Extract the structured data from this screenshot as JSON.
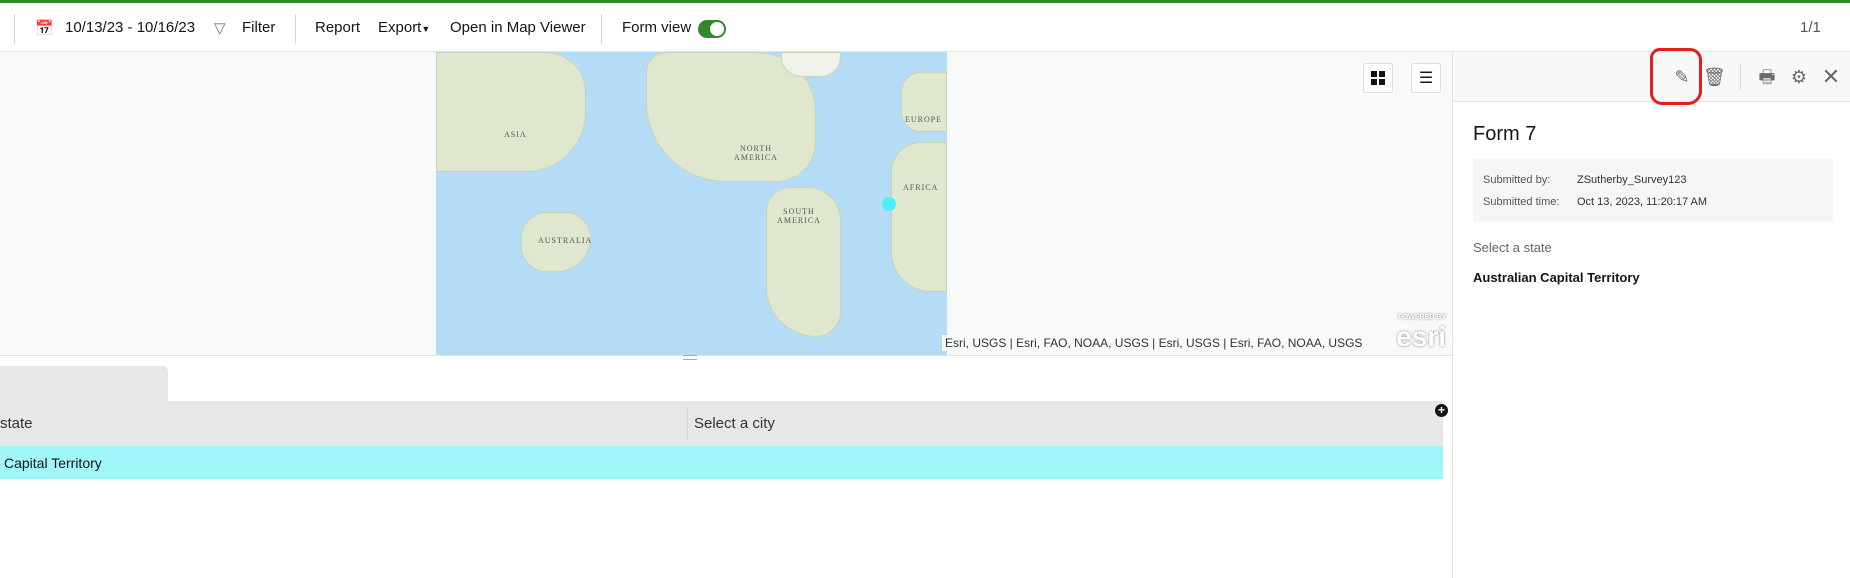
{
  "toolbar": {
    "date_range": "10/13/23 - 10/16/23",
    "filter_label": "Filter",
    "report_label": "Report",
    "export_label": "Export",
    "open_map_viewer_label": "Open in Map Viewer",
    "form_view_label": "Form view",
    "form_view_on": true,
    "record_count": "1/1"
  },
  "map": {
    "labels": [
      "ASIA",
      "NORTH AMERICA",
      "EUROPE",
      "AFRICA",
      "SOUTH AMERICA",
      "AUSTRALIA"
    ],
    "attribution": "Esri, USGS | Esri, FAO, NOAA, USGS | Esri, USGS | Esri, FAO, NOAA, USGS",
    "logo_text": "POWERED BY esri",
    "point_color": "#4ff0f5"
  },
  "table": {
    "columns": [
      "state",
      "Select a city"
    ],
    "rows": [
      {
        "state": "Capital Territory",
        "city": ""
      }
    ],
    "selected_row_color": "#a0f6f8"
  },
  "panel": {
    "title": "Form 7",
    "submitted_by_label": "Submitted by:",
    "submitted_by": "ZSutherby_Survey123",
    "submitted_time_label": "Submitted time:",
    "submitted_time": "Oct 13, 2023, 11:20:17 AM",
    "field_label": "Select a state",
    "field_value": "Australian Capital Territory"
  }
}
